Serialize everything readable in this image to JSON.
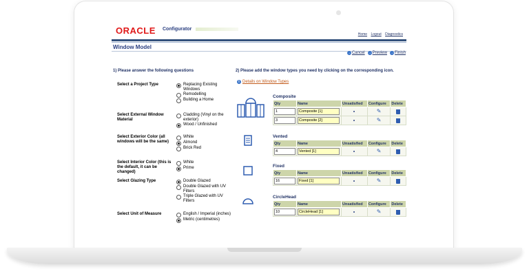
{
  "app": {
    "logo": "ORACLE",
    "product": "Configurator",
    "links": [
      "Home",
      "Logout",
      "Diagnostics"
    ],
    "page_title": "Window Model"
  },
  "actions": [
    {
      "icon": "cancel-icon",
      "label": "Cancel"
    },
    {
      "icon": "preview-icon",
      "label": "Preview"
    },
    {
      "icon": "finish-icon",
      "label": "Finish"
    }
  ],
  "step1": {
    "heading": "1) Please answer the following questions"
  },
  "step2": {
    "heading": "2) Please add the window types you need by clicking on the corresponding icon.",
    "details_link": "Details on Window Types"
  },
  "questions": [
    {
      "label": "Select a Project Type",
      "options": [
        {
          "text": "Replacing Existing Windows",
          "selected": true
        },
        {
          "text": "Remodelling",
          "selected": false
        },
        {
          "text": "Building a Home",
          "selected": false
        }
      ]
    },
    {
      "label": "Select External Window Material",
      "options": [
        {
          "text": "Cladding (Vinyl on the exterior)",
          "selected": false
        },
        {
          "text": "Wood / Unfinished",
          "selected": true
        }
      ]
    },
    {
      "label": "Select Exterior Color (all windows will be the same)",
      "options": [
        {
          "text": "White",
          "selected": false
        },
        {
          "text": "Almond",
          "selected": true
        },
        {
          "text": "Brick Red",
          "selected": false
        }
      ]
    },
    {
      "label": "Select Interior Color (this is the default, it can be changed)",
      "options": [
        {
          "text": "White",
          "selected": false
        },
        {
          "text": "Prime",
          "selected": true
        }
      ]
    },
    {
      "label": "Select Glazing Type",
      "options": [
        {
          "text": "Double Glazed",
          "selected": true
        },
        {
          "text": "Double Glazed with UV Filters",
          "selected": false
        },
        {
          "text": "Triple Glazed with UV Filters",
          "selected": false
        }
      ]
    },
    {
      "label": "Select Unit of Measure",
      "options": [
        {
          "text": "English / Imperial (inches)",
          "selected": false
        },
        {
          "text": "Metric (centimetres)",
          "selected": true
        }
      ]
    }
  ],
  "columns": [
    "Qty",
    "Name",
    "Unsatisfied",
    "Configure",
    "Delete"
  ],
  "sections": [
    {
      "name": "Composite",
      "icon": "composite-window-icon",
      "rows": [
        {
          "qty": "1",
          "name": "Composite [1]"
        },
        {
          "qty": "3",
          "name": "Composite [2]"
        }
      ]
    },
    {
      "name": "Vented",
      "icon": "vented-window-icon",
      "rows": [
        {
          "qty": "4",
          "name": "Vented [1]"
        }
      ]
    },
    {
      "name": "Fixed",
      "icon": "fixed-window-icon",
      "rows": [
        {
          "qty": "16",
          "name": "Fixed [1]"
        }
      ]
    },
    {
      "name": "CircleHead",
      "icon": "circlehead-window-icon",
      "rows": [
        {
          "qty": "10",
          "name": "CircleHead [1]"
        }
      ]
    }
  ],
  "colors": {
    "accent": "#2a3f80",
    "logo": "#e01818",
    "header_bg": "#cdd5aa",
    "name_field": "#ffffc2"
  }
}
